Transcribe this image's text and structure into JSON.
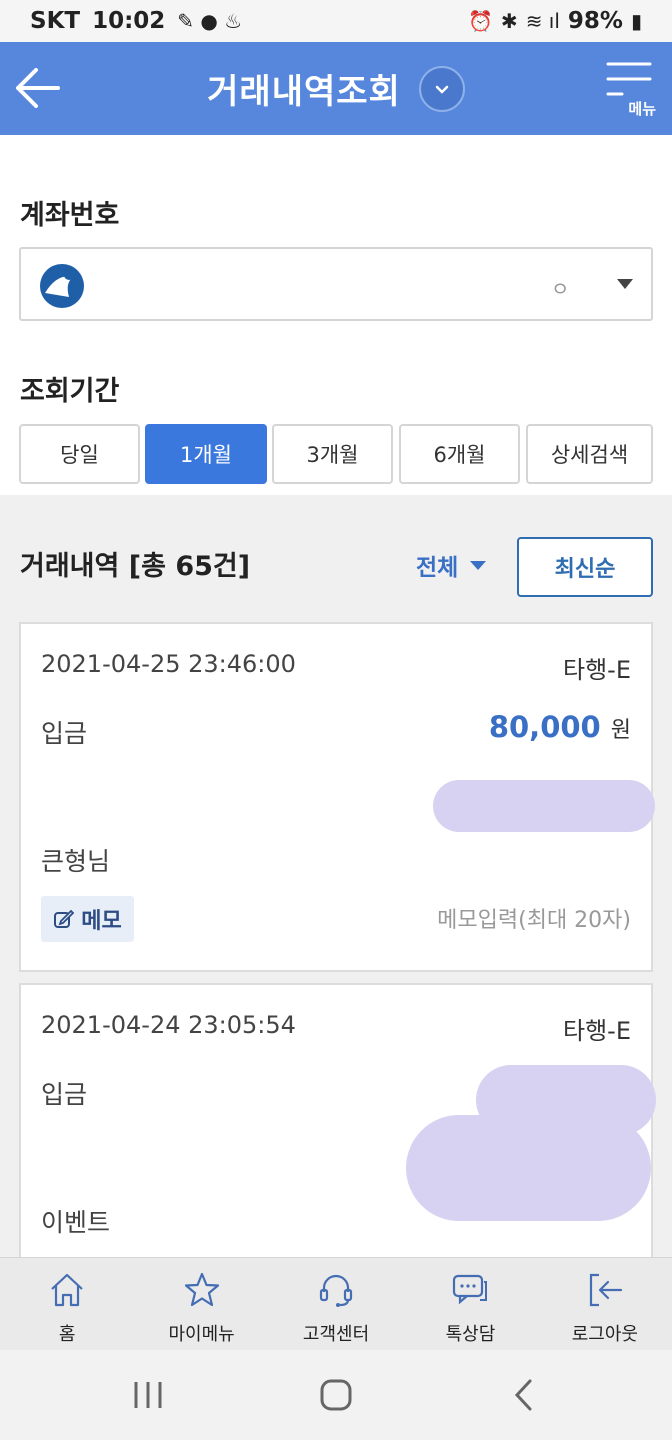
{
  "status_bar": {
    "carrier": "SKT",
    "time": "10:02",
    "battery": "98%"
  },
  "header": {
    "title": "거래내역조회",
    "menu_label": "메뉴"
  },
  "form": {
    "account_label": "계좌번호",
    "account_value": "ㅇ",
    "period_label": "조회기간",
    "periods": [
      {
        "label": "당일",
        "active": false
      },
      {
        "label": "1개월",
        "active": true
      },
      {
        "label": "3개월",
        "active": false
      },
      {
        "label": "6개월",
        "active": false
      },
      {
        "label": "상세검색",
        "active": false
      }
    ]
  },
  "list": {
    "title": "거래내역 [총 65건]",
    "filter_label": "전체",
    "sort_label": "최신순"
  },
  "transactions": [
    {
      "datetime": "2021-04-25 23:46:00",
      "bank": "타행-E",
      "type": "입금",
      "amount": "80,000",
      "currency": "원",
      "name": "큰형님",
      "memo_label": "메모",
      "memo_placeholder": "메모입력(최대 20자)"
    },
    {
      "datetime": "2021-04-24 23:05:54",
      "bank": "타행-E",
      "type": "입금",
      "name": "이벤트"
    }
  ],
  "bottom_nav": [
    {
      "label": "홈",
      "icon": "home-icon"
    },
    {
      "label": "마이메뉴",
      "icon": "star-icon"
    },
    {
      "label": "고객센터",
      "icon": "headset-icon"
    },
    {
      "label": "톡상담",
      "icon": "chat-icon"
    },
    {
      "label": "로그아웃",
      "icon": "logout-icon"
    }
  ],
  "colors": {
    "header": "#5787dc",
    "accent": "#3a78dd",
    "amount": "#3a6fc6"
  }
}
